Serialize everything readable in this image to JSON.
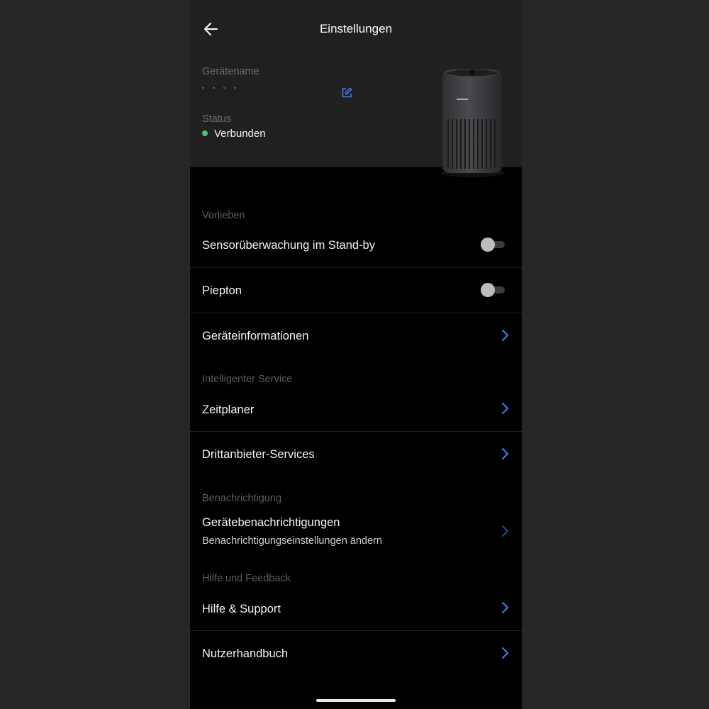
{
  "header": {
    "title": "Einstellungen",
    "device_name_label": "Gerätename",
    "status_label": "Status",
    "status_value": "Verbunden",
    "status_color": "#4ec46a",
    "edit_icon": "edit-icon",
    "back_icon": "arrow-left-icon"
  },
  "sections": {
    "preferences": "Vorlieben",
    "intelligent_service": "Intelligenter Service",
    "notification": "Benachrichtigung",
    "help": "Hilfe und Feedback"
  },
  "rows": {
    "sensor_standby": {
      "label": "Sensorüberwachung im Stand-by",
      "enabled": false
    },
    "beep": {
      "label": "Piepton",
      "enabled": false
    },
    "device_info": {
      "label": "Geräteinformationen"
    },
    "scheduler": {
      "label": "Zeitplaner"
    },
    "third_party": {
      "label": "Drittanbieter-Services"
    },
    "device_notifications": {
      "label": "Gerätebenachrichtigungen",
      "sublabel": "Benachrichtigungseinstellungen ändern"
    },
    "help_support": {
      "label": "Hilfe & Support"
    },
    "manual": {
      "label": "Nutzerhandbuch"
    }
  },
  "accent_color": "#3b82f6"
}
